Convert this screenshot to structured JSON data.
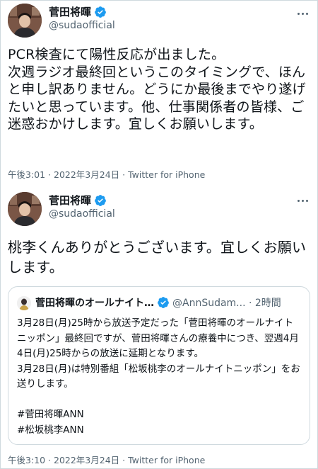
{
  "tweet1": {
    "display_name": "菅田将暉",
    "handle": "@sudaofficial",
    "text": "PCR検査にて陽性反応が出ました。\n次週ラジオ最終回というこのタイミングで、ほんと申し訳ありません。どうにか最後までやり遂げたいと思っています。他、仕事関係者の皆様、ご迷惑おかけします。宜しくお願いします。",
    "meta": "午後3:01 · 2022年3月24日 · Twitter for iPhone"
  },
  "tweet2": {
    "display_name": "菅田将暉",
    "handle": "@sudaofficial",
    "text": "桃李くんありがとうございます。宜しくお願いします。",
    "meta": "午後3:10 · 2022年3月24日 · Twitter for iPhone",
    "quote": {
      "display_name": "菅田将暉のオールナイト…",
      "handle_time": "@AnnSudam... · 2時間",
      "text": "3月28日(月)25時から放送予定だった「菅田将暉のオールナイトニッポン」最終回ですが、菅田将暉さんの療養中につき、翌週4月4日(月)25時からの放送に延期となります。\n3月28日(月)は特別番組「松坂桃李のオールナイトニッポン」をお送りします。\n\n#菅田将暉ANN\n#松坂桃李ANN"
    }
  },
  "colors": {
    "verified_blue": "#1d9bf0",
    "text_primary": "#0f1419",
    "text_secondary": "#536471",
    "border": "#cfd9de"
  },
  "icons": {
    "verified": "verified-badge-icon",
    "more": "more-options-icon"
  }
}
